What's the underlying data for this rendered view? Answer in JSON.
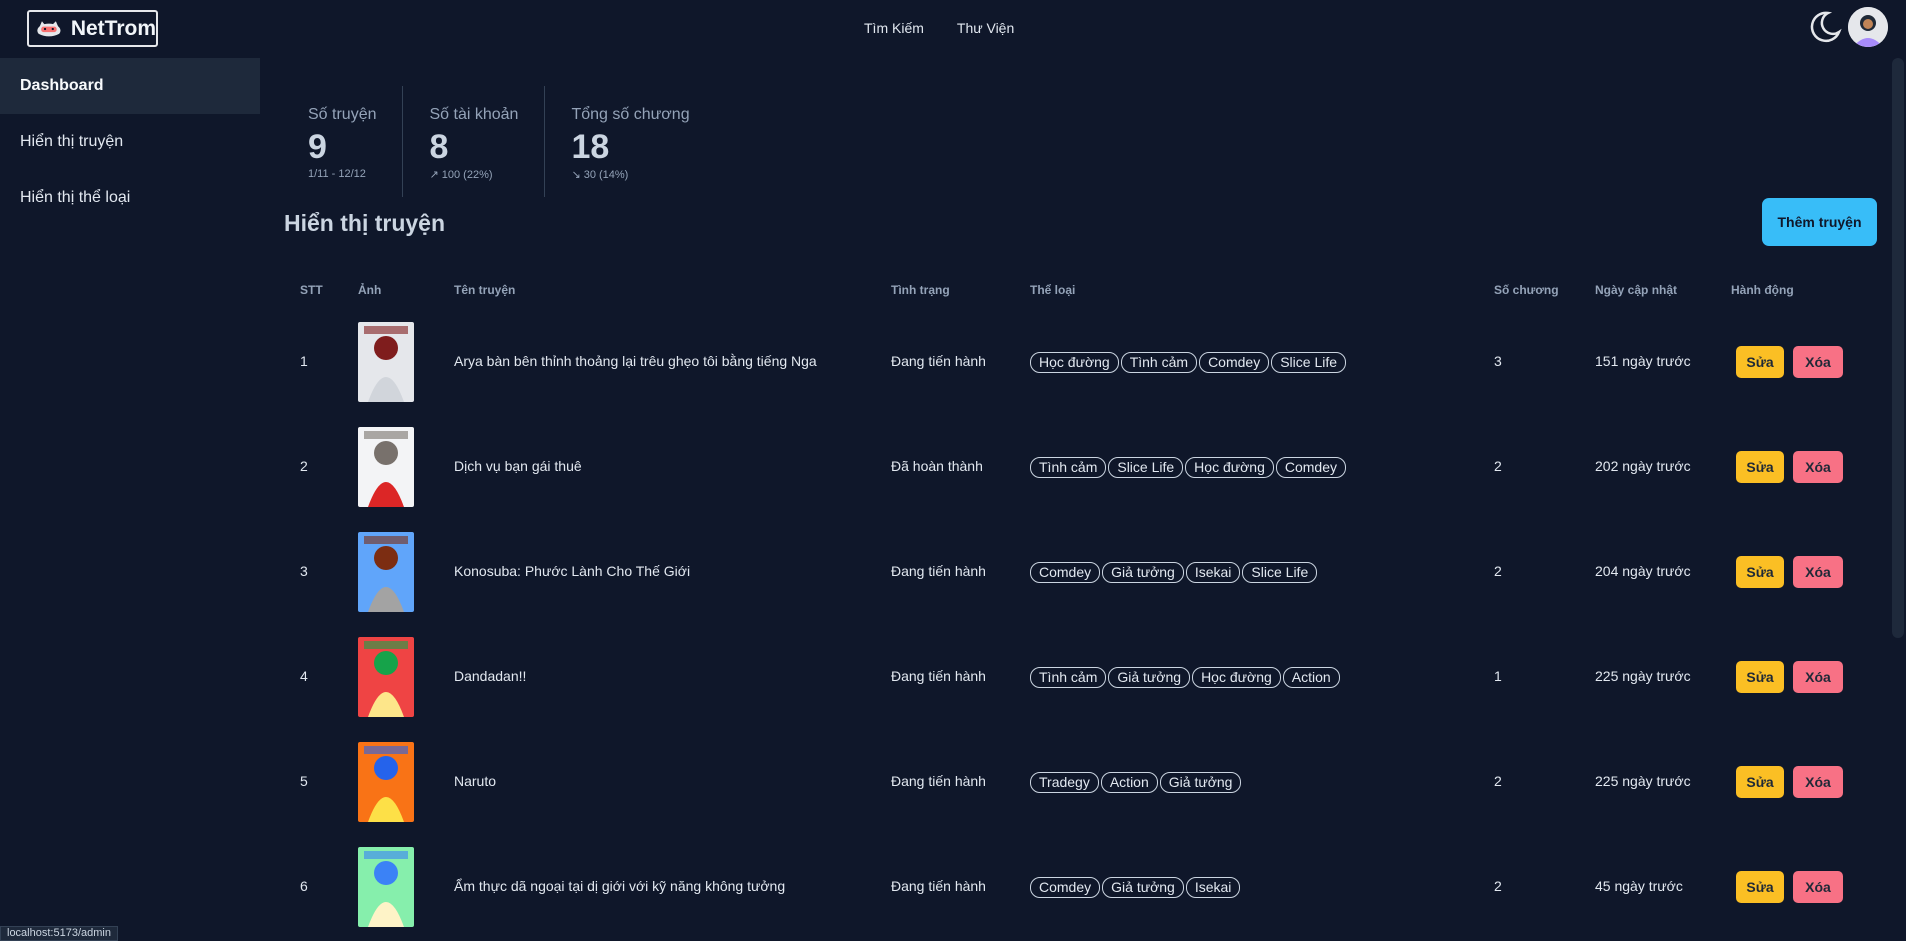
{
  "brand": {
    "name": "NetTrom"
  },
  "nav": {
    "search": "Tìm Kiếm",
    "library": "Thư Viện"
  },
  "sidebar": {
    "items": [
      {
        "label": "Dashboard",
        "active": true
      },
      {
        "label": "Hiển thị truyện",
        "active": false
      },
      {
        "label": "Hiển thị thể loại",
        "active": false
      }
    ]
  },
  "stats": [
    {
      "title": "Số truyện",
      "value": "9",
      "desc": "1/11 - 12/12"
    },
    {
      "title": "Số tài khoản",
      "value": "8",
      "desc": "↗︎ 100 (22%)"
    },
    {
      "title": "Tổng số chương",
      "value": "18",
      "desc": "↘︎ 30 (14%)"
    }
  ],
  "section": {
    "title": "Hiển thị truyện",
    "add_label": "Thêm truyện"
  },
  "table": {
    "headers": [
      "STT",
      "Ảnh",
      "Tên truyện",
      "Tình trạng",
      "Thể loại",
      "Số chương",
      "Ngày cập nhật",
      "Hành động"
    ],
    "edit_label": "Sửa",
    "delete_label": "Xóa",
    "rows": [
      {
        "stt": "1",
        "name": "Arya bàn bên thỉnh thoảng lại trêu ghẹo tôi bằng tiếng Nga",
        "status": "Đang tiến hành",
        "genres": [
          "Học đường",
          "Tình cảm",
          "Comdey",
          "Slice Life"
        ],
        "chapters": "3",
        "updated": "151 ngày trước"
      },
      {
        "stt": "2",
        "name": "Dịch vụ bạn gái thuê",
        "status": "Đã hoàn thành",
        "genres": [
          "Tình cảm",
          "Slice Life",
          "Học đường",
          "Comdey"
        ],
        "chapters": "2",
        "updated": "202 ngày trước"
      },
      {
        "stt": "3",
        "name": "Konosuba: Phước Lành Cho Thế Giới",
        "status": "Đang tiến hành",
        "genres": [
          "Comdey",
          "Giả tưởng",
          "Isekai",
          "Slice Life"
        ],
        "chapters": "2",
        "updated": "204 ngày trước"
      },
      {
        "stt": "4",
        "name": "Dandadan!!",
        "status": "Đang tiến hành",
        "genres": [
          "Tình cảm",
          "Giả tưởng",
          "Học đường",
          "Action"
        ],
        "chapters": "1",
        "updated": "225 ngày trước"
      },
      {
        "stt": "5",
        "name": "Naruto",
        "status": "Đang tiến hành",
        "genres": [
          "Tradegy",
          "Action",
          "Giả tưởng"
        ],
        "chapters": "2",
        "updated": "225 ngày trước"
      },
      {
        "stt": "6",
        "name": "Ẩm thực dã ngoại tại dị giới với kỹ năng không tưởng",
        "status": "Đang tiến hành",
        "genres": [
          "Comdey",
          "Giả tưởng",
          "Isekai"
        ],
        "chapters": "2",
        "updated": "45 ngày trước"
      }
    ]
  },
  "statusbar": {
    "url": "localhost:5173/admin"
  },
  "colors": {
    "background": "#0f172a",
    "accent": "#38bdf8",
    "edit": "#fbbf24",
    "delete": "#f87185"
  }
}
